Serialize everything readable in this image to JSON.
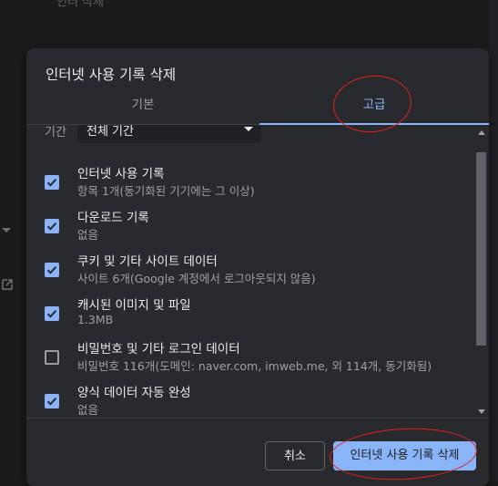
{
  "background": {
    "top_text": "인터 삭제"
  },
  "dialog": {
    "title": "인터넷 사용 기록 삭제",
    "tabs": [
      {
        "label": "기본",
        "selected": false
      },
      {
        "label": "고급",
        "selected": true
      }
    ],
    "period": {
      "label": "기간",
      "value": "전체 기간"
    },
    "items": [
      {
        "label": "인터넷 사용 기록",
        "detail": "항목 1개(동기화된 기기에는 그 이상)",
        "checked": true
      },
      {
        "label": "다운로드 기록",
        "detail": "없음",
        "checked": true
      },
      {
        "label": "쿠키 및 기타 사이트 데이터",
        "detail": "사이트 6개(Google 계정에서 로그아웃되지 않음)",
        "checked": true
      },
      {
        "label": "캐시된 이미지 및 파일",
        "detail": "1.3MB",
        "checked": true
      },
      {
        "label": "비밀번호 및 기타 로그인 데이터",
        "detail": "비밀번호 116개(도메인: naver.com, imweb.me, 외 114개, 동기화됨)",
        "checked": false
      },
      {
        "label": "양식 데이터 자동 완성",
        "detail": "없음",
        "checked": true
      }
    ],
    "buttons": {
      "cancel": "취소",
      "clear": "인터넷 사용 기록 삭제"
    }
  },
  "colors": {
    "accent": "#8ab4f8",
    "dialog_bg": "#292a2d",
    "annotation": "#e02020"
  }
}
